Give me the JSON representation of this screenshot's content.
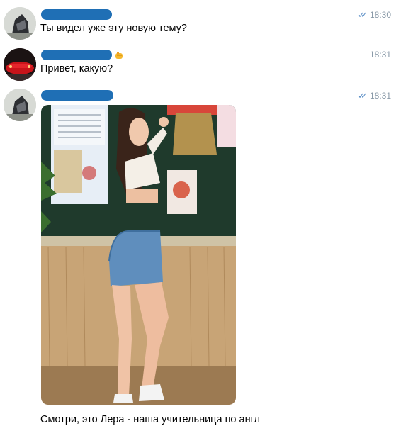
{
  "messages": [
    {
      "time": "18:30",
      "read": true,
      "text": "Ты видел уже эту новую тему?"
    },
    {
      "time": "18:31",
      "read": false,
      "text": "Привет, какую?",
      "name_emoji": "fist-emoji"
    },
    {
      "time": "18:31",
      "read": true,
      "text": "Смотри, это Лера - наша учительница по англ"
    }
  ],
  "icons": {
    "read_receipt": "double-check-icon",
    "attachment": "photo"
  },
  "colors": {
    "name_redaction": "#1f6fb5",
    "time": "#8a9aa8",
    "check": "#5b8fc7"
  }
}
